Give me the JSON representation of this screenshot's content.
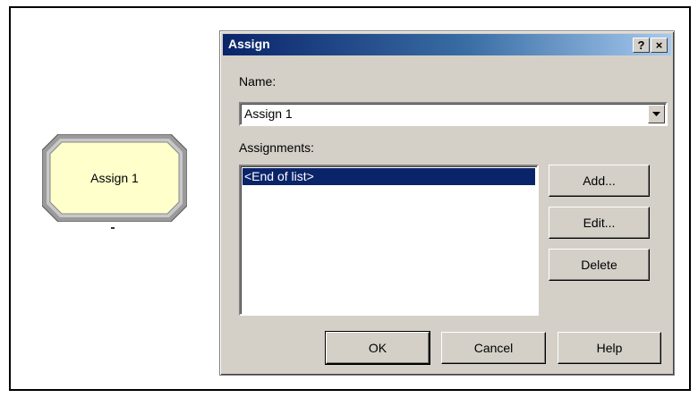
{
  "canvas": {
    "module": {
      "label": "Assign 1",
      "fill_color": "#ffffcc",
      "border_color": "#9a9a9a"
    }
  },
  "dialog": {
    "title": "Assign",
    "help_button": "?",
    "close_button": "×",
    "name_label": "Name:",
    "name_value": "Assign 1",
    "assignments_label": "Assignments:",
    "assignments": [
      "<End of list>"
    ],
    "side_buttons": {
      "add": "Add...",
      "edit": "Edit...",
      "delete": "Delete"
    },
    "footer_buttons": {
      "ok": "OK",
      "cancel": "Cancel",
      "help": "Help"
    }
  }
}
